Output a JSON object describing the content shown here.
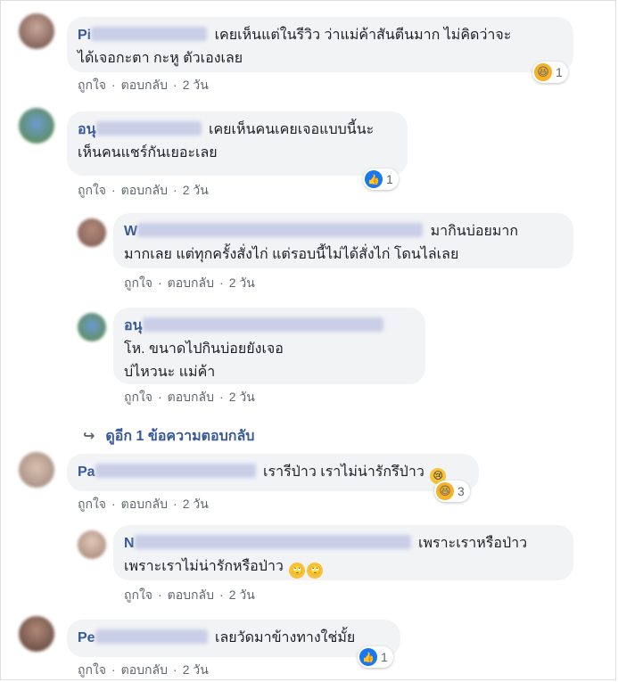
{
  "actions": {
    "like": "ถูกใจ",
    "reply": "ตอบกลับ",
    "dot": "·"
  },
  "comments": [
    {
      "author": "Pi",
      "text_line1": "เคยเห็นแต่ในรีวิว ว่าแม่ค้าสันตีนมาก ไม่คิดว่าจะ",
      "text_line2": "ได้เจอกะตา กะหู ตัวเองเลย",
      "time": "2 วัน",
      "reaction": {
        "type": "haha-icon",
        "count": "1"
      }
    },
    {
      "author": "อนุ",
      "text_line1": "เคยเห็นคนเคยเจอแบบนี้นะ",
      "text_line2": "เห็นคนแชร์กันเยอะเลย",
      "time": "2 วัน",
      "reaction": {
        "type": "like-icon",
        "count": "1"
      }
    },
    {
      "author": "W",
      "text_line1": "มากินบ่อยมาก",
      "text_line2": "มากเลย แต่ทุกครั้งสั่งไก่ แต่รอบนี้ไม่ได้สั่งไก่ โดนไล่เลย",
      "time": "2 วัน"
    },
    {
      "author": "อนุ",
      "text_line1": "โห. ขนาดไปกินบ่อยยังเจอ",
      "text_line2": "บ่ไหวนะ แม่ค้า",
      "time": "2 วัน"
    },
    {
      "author": "Pa",
      "text_line1": "เรารีป่าว เราไม่น่ารักรึป่าว",
      "time": "2 วัน",
      "reaction": {
        "type": "haha-icon",
        "count": "3"
      }
    },
    {
      "author": "N",
      "text_line1": "เพราะเราหรือป่าว",
      "text_line2": "เพราะเราไม่น่ารักหรือป่าว",
      "time": "2 วัน"
    },
    {
      "author": "Pe",
      "text_line1": "เลยวัดมาข้างทางใช่มั้ย",
      "time": "2 วัน",
      "reaction": {
        "type": "like-icon",
        "count": "1"
      }
    }
  ],
  "more_replies": {
    "label": "ดูอีก 1 ข้อความตอบกลับ",
    "icon": "reply-arrow-icon"
  },
  "colors": {
    "author": "#385898",
    "bubble": "#f2f3f5",
    "meta": "#606770",
    "like": "#1877f2",
    "haha": "#f7b125"
  }
}
